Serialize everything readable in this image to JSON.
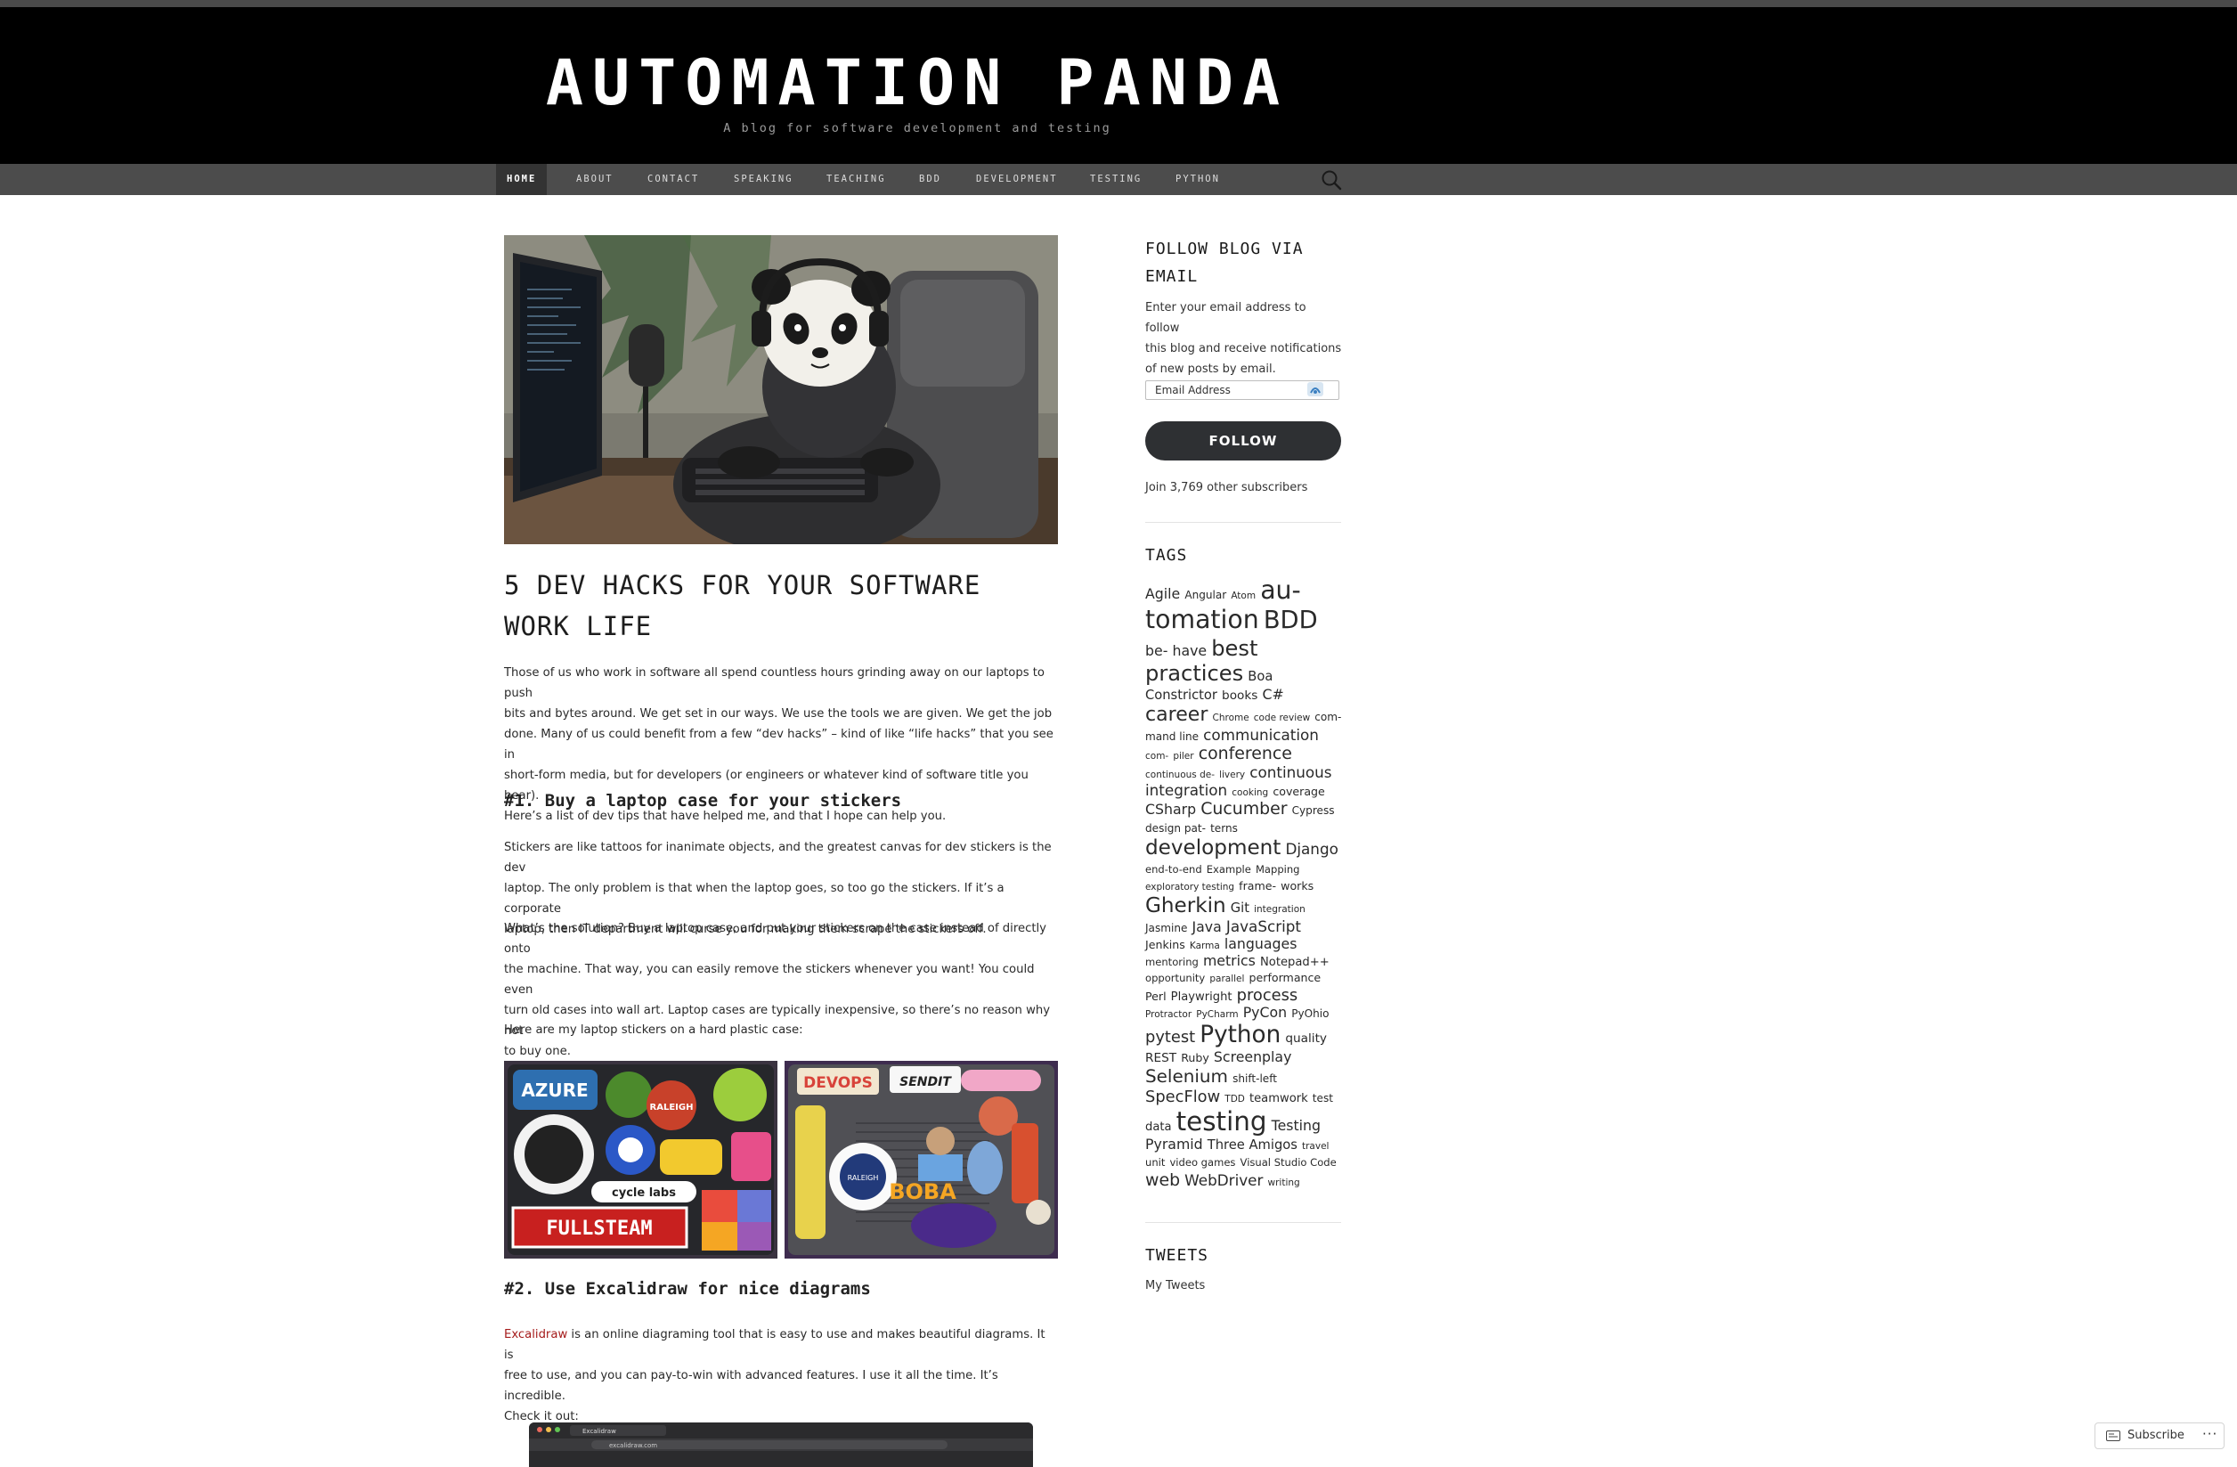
{
  "site": {
    "title": "AUTOMATION PANDA",
    "tagline": "A blog for software development and testing"
  },
  "nav": {
    "items": [
      "Home",
      "About",
      "Contact",
      "Speaking",
      "Teaching",
      "BDD",
      "Development",
      "Testing",
      "Python"
    ],
    "active": "Home",
    "search_icon": "search-icon"
  },
  "post": {
    "title_line1": "5 DEV HACKS FOR YOUR SOFTWARE",
    "title_line2": "WORK LIFE",
    "intro_lines": [
      "Those of us who work in software all spend countless hours grinding away on our laptops to push",
      "bits and bytes around. We get set in our ways. We use the tools we are given. We get the job",
      "done. Many of us could benefit from a few “dev hacks” – kind of like “life hacks” that you see in",
      "short-form media, but for developers (or engineers or whatever kind of software title you bear).",
      "Here’s a list of dev tips that have helped me, and that I hope can help you."
    ],
    "h1": "#1. Buy a laptop case for your stickers",
    "p1_lines": [
      "Stickers are like tattoos for inanimate objects, and the greatest canvas for dev stickers is the dev",
      "laptop. The only problem is that when the laptop goes, so too go the stickers. If it’s a corporate",
      "laptop, then IT department will curse you for making them scrape the stickers off."
    ],
    "p2_lines": [
      "What’s the solution? Buy a laptop case, and put your stickers on the case instead of directly onto",
      "the machine. That way, you can easily remove the stickers whenever you want! You could even",
      "turn old cases into wall art. Laptop cases are typically inexpensive, so there’s no reason why not",
      "to buy one."
    ],
    "p3": "Here are my laptop stickers on a hard plastic case:",
    "stickers_left": [
      "AZURE",
      "RALEIGH",
      "cycle labs",
      "FULLSTEAM"
    ],
    "stickers_right": [
      "DEVOPS",
      "SENDIT",
      "RALEIGH",
      "BOBA"
    ],
    "h2": "#2. Use Excalidraw for nice diagrams",
    "p4_link": "Excalidraw",
    "p4_line1": " is an online diagraming tool that is easy to use and makes beautiful diagrams. It is",
    "p4_line2": "free to use, and you can pay-to-win with advanced features. I use it all the time. It’s incredible.",
    "p4_line3": "Check it out:",
    "browser_tab": "Excalidraw",
    "browser_url": "excalidraw.com"
  },
  "sidebar": {
    "follow_title_1": "FOLLOW BLOG VIA",
    "follow_title_2": "EMAIL",
    "follow_desc_lines": [
      "Enter your email address to follow",
      "this blog and receive notifications",
      "of new posts by email."
    ],
    "email_placeholder": "Email Address",
    "follow_button": "FOLLOW",
    "subscribers": "Join 3,769 other subscribers",
    "tags_title": "TAGS",
    "tweets_title": "TWEETS",
    "tweets_link": "My Tweets",
    "tags": [
      {
        "t": "Agile",
        "s": 15
      },
      {
        "t": "Angular",
        "s": 11.5
      },
      {
        "t": "Atom",
        "s": 10
      },
      {
        "t": "au-",
        "s": 27
      },
      {
        "t": "tomation",
        "s": 27
      },
      {
        "t": "BDD",
        "s": 26
      },
      {
        "t": "be-",
        "s": 15
      },
      {
        "t": "have",
        "s": 15
      },
      {
        "t": "best practices",
        "s": 23
      },
      {
        "t": "Boa Constrictor",
        "s": 14
      },
      {
        "t": "books",
        "s": 13
      },
      {
        "t": "C#",
        "s": 15
      },
      {
        "t": "career",
        "s": 21
      },
      {
        "t": "Chrome",
        "s": 10
      },
      {
        "t": "code review",
        "s": 10
      },
      {
        "t": "com-",
        "s": 11.5
      },
      {
        "t": "mand line",
        "s": 11.5
      },
      {
        "t": "communication",
        "s": 16
      },
      {
        "t": "com-",
        "s": 10
      },
      {
        "t": "piler",
        "s": 10
      },
      {
        "t": "conference",
        "s": 18
      },
      {
        "t": "continuous de-",
        "s": 10
      },
      {
        "t": "livery",
        "s": 10
      },
      {
        "t": "continuous integration",
        "s": 16
      },
      {
        "t": "cooking",
        "s": 10
      },
      {
        "t": "coverage",
        "s": 12
      },
      {
        "t": "CSharp",
        "s": 15
      },
      {
        "t": "Cucumber",
        "s": 18
      },
      {
        "t": "Cypress",
        "s": 11.5
      },
      {
        "t": "design pat-",
        "s": 11.5
      },
      {
        "t": "terns",
        "s": 11.5
      },
      {
        "t": "development",
        "s": 22
      },
      {
        "t": "Django",
        "s": 16
      },
      {
        "t": "end-to-end",
        "s": 11
      },
      {
        "t": "Example",
        "s": 11
      },
      {
        "t": "Mapping",
        "s": 11
      },
      {
        "t": "exploratory testing",
        "s": 10
      },
      {
        "t": "frame-",
        "s": 12
      },
      {
        "t": "works",
        "s": 12
      },
      {
        "t": "Gherkin",
        "s": 22
      },
      {
        "t": "Git",
        "s": 14
      },
      {
        "t": "integration",
        "s": 10
      },
      {
        "t": "Jasmine",
        "s": 11.5
      },
      {
        "t": "Java",
        "s": 15
      },
      {
        "t": "JavaScript",
        "s": 16
      },
      {
        "t": "Jenkins",
        "s": 12
      },
      {
        "t": "Karma",
        "s": 10
      },
      {
        "t": "languages",
        "s": 15
      },
      {
        "t": "mentoring",
        "s": 11
      },
      {
        "t": "metrics",
        "s": 15
      },
      {
        "t": "Notepad++",
        "s": 12.5
      },
      {
        "t": "opportunity",
        "s": 11
      },
      {
        "t": "parallel",
        "s": 10
      },
      {
        "t": "performance",
        "s": 12
      },
      {
        "t": "Perl",
        "s": 12
      },
      {
        "t": "Playwright",
        "s": 12.5
      },
      {
        "t": "process",
        "s": 17
      },
      {
        "t": "Protractor",
        "s": 10
      },
      {
        "t": "PyCharm",
        "s": 10
      },
      {
        "t": "PyCon",
        "s": 15
      },
      {
        "t": "PyOhio",
        "s": 11.5
      },
      {
        "t": "pytest",
        "s": 17
      },
      {
        "t": "Python",
        "s": 25
      },
      {
        "t": "quality",
        "s": 13
      },
      {
        "t": "REST",
        "s": 13
      },
      {
        "t": "Ruby",
        "s": 12
      },
      {
        "t": "Screenplay",
        "s": 15
      },
      {
        "t": "Selenium",
        "s": 19
      },
      {
        "t": "shift-left",
        "s": 11.5
      },
      {
        "t": "SpecFlow",
        "s": 17
      },
      {
        "t": "TDD",
        "s": 10
      },
      {
        "t": "teamwork",
        "s": 12.5
      },
      {
        "t": "test",
        "s": 11.5
      },
      {
        "t": "data",
        "s": 12.5
      },
      {
        "t": "testing",
        "s": 28
      },
      {
        "t": "Testing",
        "s": 15
      },
      {
        "t": "Pyramid",
        "s": 15
      },
      {
        "t": "Three Amigos",
        "s": 14
      },
      {
        "t": "travel",
        "s": 10
      },
      {
        "t": "unit",
        "s": 11
      },
      {
        "t": "video games",
        "s": 11
      },
      {
        "t": "Visual Studio Code",
        "s": 11
      },
      {
        "t": "web",
        "s": 18
      },
      {
        "t": "WebDriver",
        "s": 16
      },
      {
        "t": "writing",
        "s": 10
      }
    ]
  },
  "footer": {
    "subscribe_label": "Subscribe",
    "more_label": "···"
  },
  "colors": {
    "masthead": "#000000",
    "navbar": "#4c4c4c",
    "link": "#a51c1c",
    "button": "#2e3033"
  }
}
